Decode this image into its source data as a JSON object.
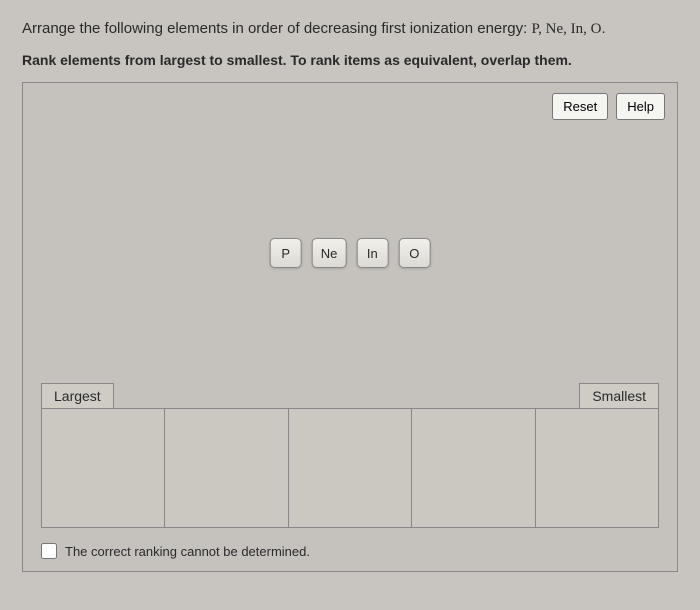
{
  "question": {
    "prefix": "Arrange the following elements in order of decreasing first ionization energy: ",
    "elements_list": "P, Ne, In, O",
    "suffix": "."
  },
  "instruction": "Rank elements from largest to smallest. To rank items as equivalent, overlap them.",
  "buttons": {
    "reset": "Reset",
    "help": "Help"
  },
  "elements": [
    "P",
    "Ne",
    "In",
    "O"
  ],
  "ranking": {
    "largest_label": "Largest",
    "smallest_label": "Smallest",
    "slot_count": 5
  },
  "checkbox_label": "The correct ranking cannot be determined."
}
